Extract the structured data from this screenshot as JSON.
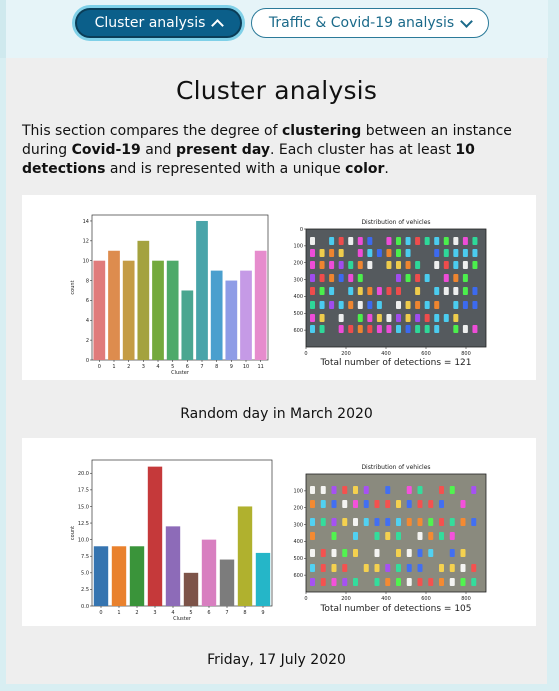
{
  "nav": {
    "cluster_label": "Cluster analysis",
    "traffic_label": "Traffic & Covid-19 analysis"
  },
  "section": {
    "title": "Cluster analysis",
    "desc": {
      "p1": "This section compares the degree of ",
      "b1": "clustering",
      "p2": " between an instance during ",
      "b2": "Covid-19",
      "p3": " and ",
      "b3": "present day",
      "p4": ". Each cluster has at least ",
      "b4": "10 detections",
      "p5": " and is represented with a unique ",
      "b5": "color",
      "p6": "."
    }
  },
  "figures": [
    {
      "caption": "Random day in March 2020",
      "detections_label": "Total number of detections = 121",
      "map_title": "Distribution of vehicles",
      "map_x_ticks": [
        "0",
        "200",
        "400",
        "600",
        "800"
      ],
      "map_y_ticks": [
        "0",
        "100",
        "200",
        "300",
        "400",
        "500",
        "600"
      ]
    },
    {
      "caption": "Friday, 17 July 2020",
      "detections_label": "Total number of detections = 105",
      "map_title": "Distribution of vehicles",
      "map_x_ticks": [
        "0",
        "200",
        "400",
        "600",
        "800"
      ],
      "map_y_ticks": [
        "100",
        "200",
        "300",
        "400",
        "500",
        "600"
      ]
    }
  ],
  "chart_data": [
    {
      "type": "bar",
      "xlabel": "Cluster",
      "ylabel": "count",
      "categories": [
        "0",
        "1",
        "2",
        "3",
        "4",
        "5",
        "6",
        "7",
        "8",
        "9",
        "10",
        "11"
      ],
      "values": [
        10,
        11,
        10,
        12,
        10,
        10,
        7,
        14,
        9,
        8,
        9,
        11
      ],
      "ylim": [
        0,
        14.6
      ],
      "yticks": [
        "0",
        "2",
        "4",
        "6",
        "8",
        "10",
        "12",
        "14"
      ],
      "colors": [
        "#e07b7b",
        "#dd8c4e",
        "#c49c45",
        "#a4a23e",
        "#74a93d",
        "#4eaa6a",
        "#4aa690",
        "#49a4a9",
        "#4a9fce",
        "#8e9ce6",
        "#c59ae6",
        "#e68ccd"
      ]
    },
    {
      "type": "bar",
      "xlabel": "Cluster",
      "ylabel": "count",
      "categories": [
        "0",
        "1",
        "2",
        "3",
        "4",
        "5",
        "6",
        "7",
        "8",
        "9"
      ],
      "values": [
        9,
        9,
        9,
        21,
        12,
        5,
        10,
        7,
        15,
        8
      ],
      "ylim": [
        0,
        22
      ],
      "yticks": [
        "0.0",
        "2.5",
        "5.0",
        "7.5",
        "10.0",
        "12.5",
        "15.0",
        "17.5",
        "20.0"
      ],
      "colors": [
        "#3574b0",
        "#e9812d",
        "#3a943a",
        "#c5393a",
        "#8d6bb8",
        "#7d5449",
        "#d87fc0",
        "#7c7c7c",
        "#b0b12e",
        "#25b6c8"
      ]
    }
  ]
}
